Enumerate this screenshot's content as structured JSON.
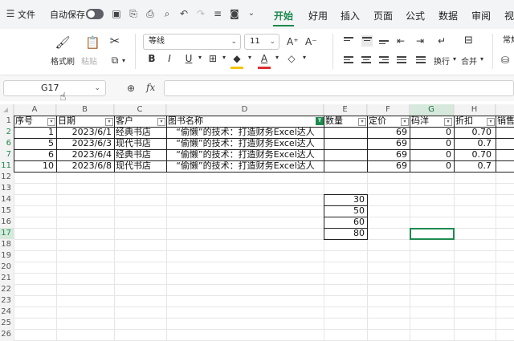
{
  "titlebar": {
    "file_menu": "文件",
    "autosave": "自动保存",
    "tabs": [
      "开始",
      "好用",
      "插入",
      "页面",
      "公式",
      "数据",
      "审阅",
      "视"
    ],
    "active_tab": "开始"
  },
  "ribbon": {
    "format_painter": "格式刷",
    "paste": "粘贴",
    "font_name": "等线",
    "font_size": "11",
    "wrap": "换行",
    "merge": "合并",
    "number_format": "常规",
    "accent_color": "#1d8a4e",
    "font_color": "#e03030",
    "fill_color": "#f5c400"
  },
  "formula_bar": {
    "name_box": "G17",
    "fx_label": "fx",
    "content": ""
  },
  "sheet": {
    "columns": [
      "A",
      "B",
      "C",
      "D",
      "E",
      "F",
      "G",
      "H"
    ],
    "selected_column": "G",
    "row_numbers": [
      "1",
      "2",
      "6",
      "7",
      "11",
      "12",
      "13",
      "14",
      "15",
      "16",
      "17",
      "18",
      "19",
      "20",
      "21",
      "22",
      "23",
      "24",
      "25",
      "26",
      "27"
    ],
    "headers": [
      "序号",
      "日期",
      "客户",
      "图书名称",
      "数量",
      "定价",
      "码洋",
      "折扣",
      "销售"
    ],
    "rows": [
      [
        "1",
        "2023/6/1",
        "经典书店",
        "“偷懒”的技术：打造财务Excel达人",
        "",
        "69",
        "0",
        "0.70"
      ],
      [
        "5",
        "2023/6/3",
        "现代书店",
        "“偷懒”的技术：打造财务Excel达人",
        "",
        "69",
        "0",
        "0.7"
      ],
      [
        "6",
        "2023/6/4",
        "经典书店",
        "“偷懒”的技术：打造财务Excel达人",
        "",
        "69",
        "0",
        "0.70"
      ],
      [
        "10",
        "2023/6/8",
        "现代书店",
        "“偷懒”的技术：打造财务Excel达人",
        "",
        "69",
        "0",
        "0.7"
      ]
    ],
    "side_values": [
      "30",
      "50",
      "60",
      "80"
    ],
    "active_cell": "G17"
  }
}
